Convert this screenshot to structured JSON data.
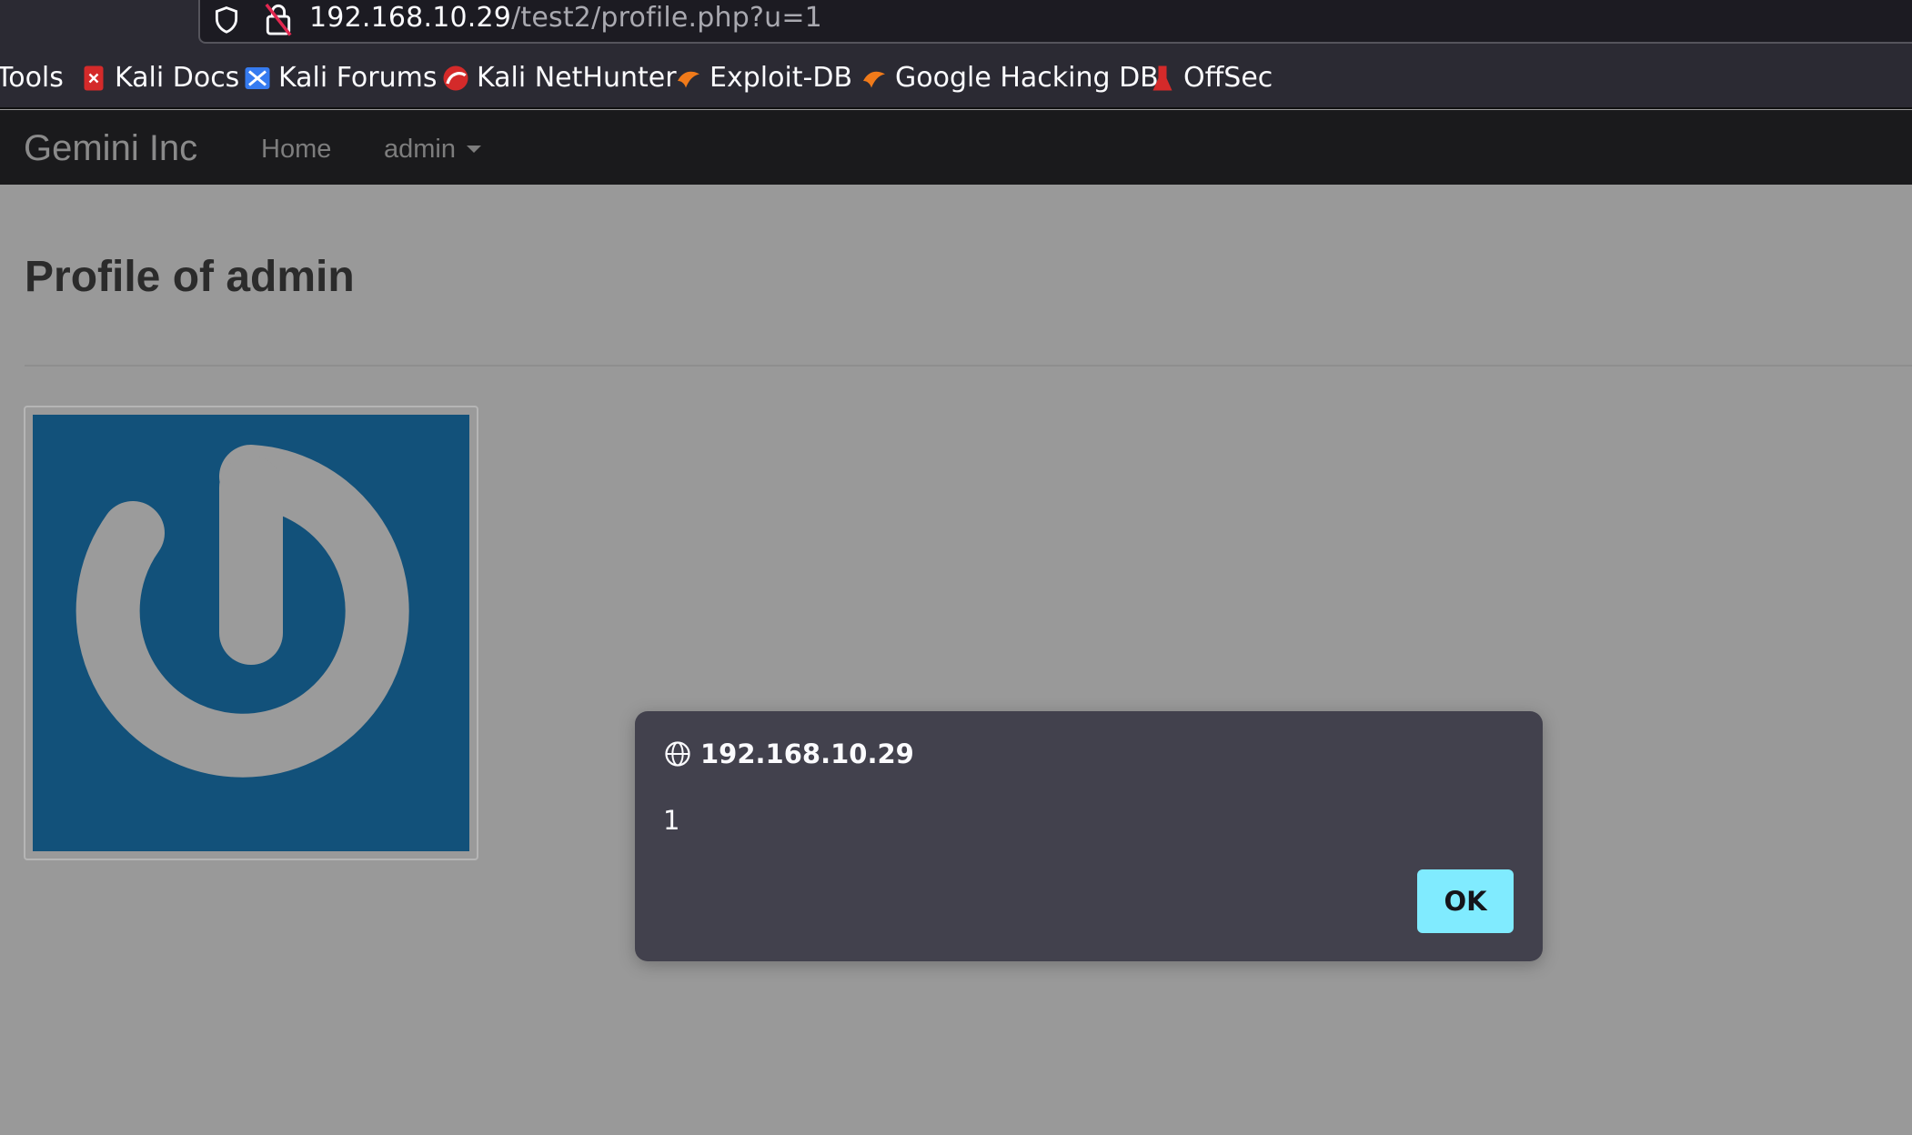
{
  "browser": {
    "url_host": "192.168.10.29",
    "url_path": "/test2/profile.php?u=1",
    "bookmarks": [
      {
        "label": "Tools",
        "icon": "kali-tools-icon"
      },
      {
        "label": "Kali Docs",
        "icon": "kali-docs-icon"
      },
      {
        "label": "Kali Forums",
        "icon": "kali-forums-icon"
      },
      {
        "label": "Kali NetHunter",
        "icon": "kali-nethunter-icon"
      },
      {
        "label": "Exploit-DB",
        "icon": "exploit-db-icon"
      },
      {
        "label": "Google Hacking DB",
        "icon": "ghdb-icon"
      },
      {
        "label": "OffSec",
        "icon": "offsec-icon"
      }
    ]
  },
  "site": {
    "brand": "Gemini Inc",
    "nav": {
      "home": "Home",
      "admin": "admin"
    },
    "page_title": "Profile of admin",
    "avatar_icon": "power-logo-icon"
  },
  "dialog": {
    "origin": "192.168.10.29",
    "message": "1",
    "ok_label": "OK"
  },
  "colors": {
    "page_background": "#999999",
    "navbar_background": "#1a1a1c",
    "browser_chrome": "#2b2a33",
    "dialog_background": "#42414d",
    "ok_button": "#80ebff",
    "avatar_background": "#12517a"
  }
}
